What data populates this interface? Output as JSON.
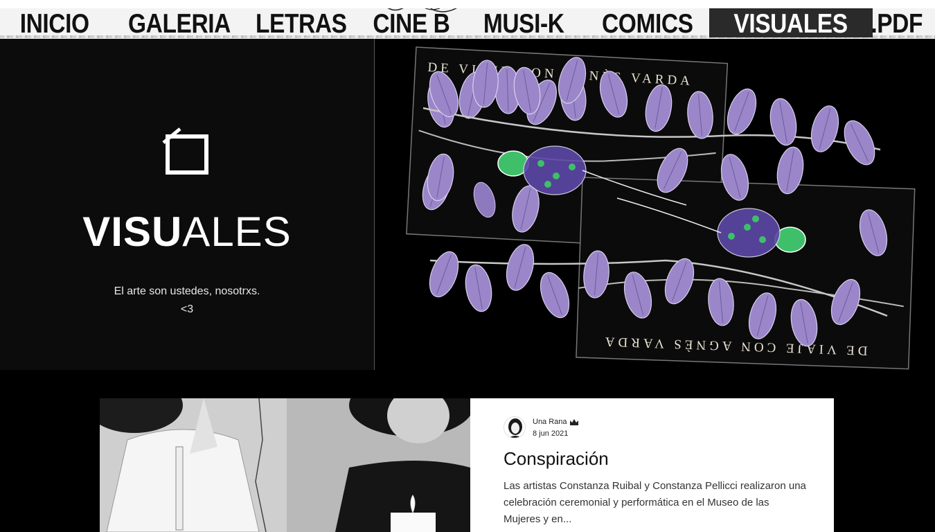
{
  "nav": {
    "items": [
      {
        "label": "INICIO"
      },
      {
        "label": "GALERIA"
      },
      {
        "label": "LETRAS"
      },
      {
        "label": "CINE B"
      },
      {
        "label": "MUSI-K"
      },
      {
        "label": "COMICS"
      },
      {
        "label": "VISUALES",
        "active": true
      },
      {
        "label": ".PDF"
      }
    ]
  },
  "hero": {
    "icon": "frame-icon",
    "title_strong": "VISU",
    "title_light": "ALES",
    "subtitle_line1": "El arte son ustedes, nosotrxs.",
    "subtitle_line2": "<3",
    "artwork": {
      "text_top": "DE VIAJE CON AGNÈS VARDA",
      "text_bottom": "DE VIAJE CON AGNÈS VARDA"
    }
  },
  "post": {
    "author": "Una Rana",
    "author_badge_icon": "crown-icon",
    "date": "8 jun 2021",
    "title": "Conspiración",
    "excerpt": "Las artistas Constanza Ruibal y Constanza Pellicci realizaron una celebración ceremonial y performática en el Museo de las Mujeres y en..."
  },
  "colors": {
    "nav_bg": "#f3f3f3",
    "nav_active_bg": "#2a2a2a",
    "page_bg": "#000000",
    "hero_panel_bg": "#0c0c0d",
    "accent_lilac": "#9a86c8",
    "accent_green": "#3fbf6a"
  }
}
